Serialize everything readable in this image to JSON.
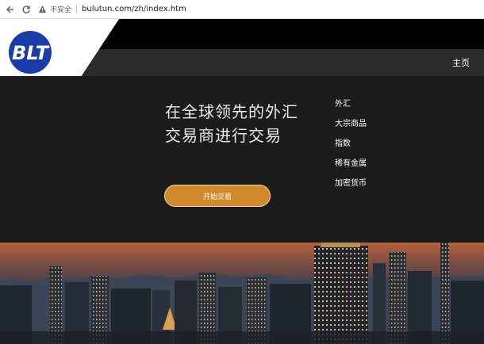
{
  "browser": {
    "security_label": "不安全",
    "url": "bulutun.com/zh/index.htm"
  },
  "header": {
    "logo_text": "BLT",
    "home_label": "主页"
  },
  "hero": {
    "headline": "在全球领先的外汇交易商进行交易",
    "cta_label": "开始交易"
  },
  "side_menu": [
    {
      "label": "外汇"
    },
    {
      "label": "大宗商品"
    },
    {
      "label": "指数"
    },
    {
      "label": "稀有金属"
    },
    {
      "label": "加密货币"
    }
  ],
  "colors": {
    "cta_bg": "#d18a2b",
    "logo_circle": "#1a3ba8",
    "hero_bg": "#1c1c1c"
  }
}
